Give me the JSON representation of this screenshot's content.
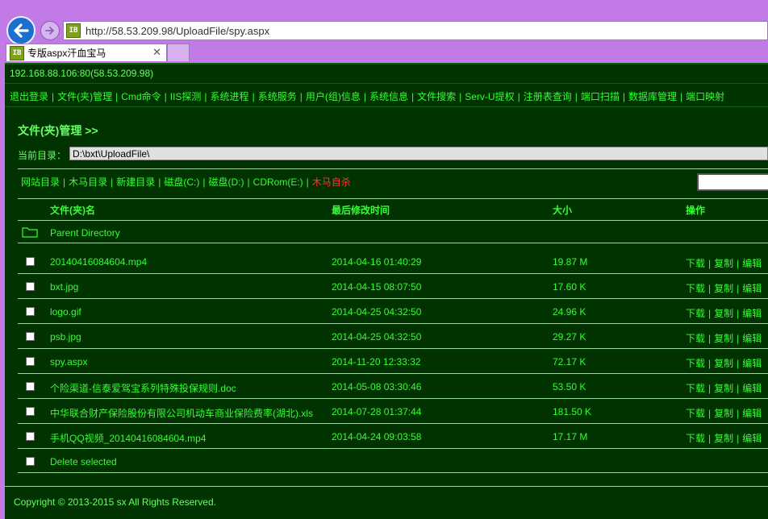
{
  "browser": {
    "url": "http://58.53.209.98/UploadFile/spy.aspx",
    "tab_title": "专版aspx汗血宝马",
    "tab_close": "✕",
    "site_icon_text": "IB"
  },
  "page": {
    "host": "192.168.88.106:80(58.53.209.98)",
    "menu": [
      "退出登录",
      "文件(夹)管理",
      "Cmd命令",
      "IIS探测",
      "系统进程",
      "系统服务",
      "用户(组)信息",
      "系统信息",
      "文件搜索",
      "Serv-U提权",
      "注册表查询",
      "端口扫描",
      "数据库管理",
      "端口映射"
    ],
    "heading": "文件(夹)管理 >>",
    "current_dir_label": "当前目录：",
    "current_dir_value": "D:\\bxt\\UploadFile\\",
    "quick_links": [
      "网站目录",
      "木马目录",
      "新建目录",
      "磁盘(C:)",
      "磁盘(D:)",
      "CDRom(E:)"
    ],
    "danger_link": "木马自杀",
    "table_headers": {
      "name": "文件(夹)名",
      "modified": "最后修改时间",
      "size": "大小",
      "action": "操作"
    },
    "parent_directory": "Parent Directory",
    "files": [
      {
        "name": "20140416084604.mp4",
        "modified": "2014-04-16 01:40:29",
        "size": "19.87 M"
      },
      {
        "name": "bxt.jpg",
        "modified": "2014-04-15 08:07:50",
        "size": "17.60 K"
      },
      {
        "name": "logo.gif",
        "modified": "2014-04-25 04:32:50",
        "size": "24.96 K"
      },
      {
        "name": "psb.jpg",
        "modified": "2014-04-25 04:32:50",
        "size": "29.27 K"
      },
      {
        "name": "spy.aspx",
        "modified": "2014-11-20 12:33:32",
        "size": "72.17 K"
      },
      {
        "name": "个险渠道-信泰爱驾宝系列特殊投保规则.doc",
        "modified": "2014-05-08 03:30:46",
        "size": "53.50 K"
      },
      {
        "name": "中华联合财产保险股份有限公司机动车商业保险费率(湖北).xls",
        "modified": "2014-07-28 01:37:44",
        "size": "181.50 K"
      },
      {
        "name": "手机QQ视频_20140416084604.mp4",
        "modified": "2014-04-24 09:03:58",
        "size": "17.17 M"
      }
    ],
    "actions": {
      "download": "下载",
      "copy": "复制",
      "edit": "编辑"
    },
    "delete_selected": "Delete selected",
    "footer": "Copyright © 2013-2015 sx All Rights Reserved."
  }
}
